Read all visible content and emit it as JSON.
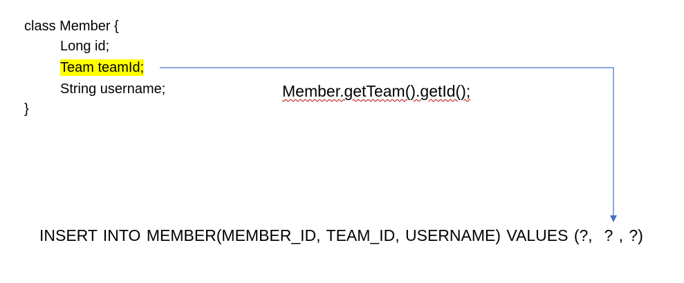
{
  "code": {
    "class_decl": "class Member {",
    "field_id": "Long id;",
    "field_team": "Team teamId;",
    "field_username": "String username;",
    "closing_brace": "}"
  },
  "method_call": {
    "text": "Member.getTeam().getId();"
  },
  "sql": {
    "statement": "INSERT INTO MEMBER(MEMBER_ID, TEAM_ID, USERNAME) VALUES (?,  ? , ?)"
  },
  "colors": {
    "highlight": "#ffff00",
    "arrow": "#4472c4",
    "spellcheck": "#c00000"
  }
}
